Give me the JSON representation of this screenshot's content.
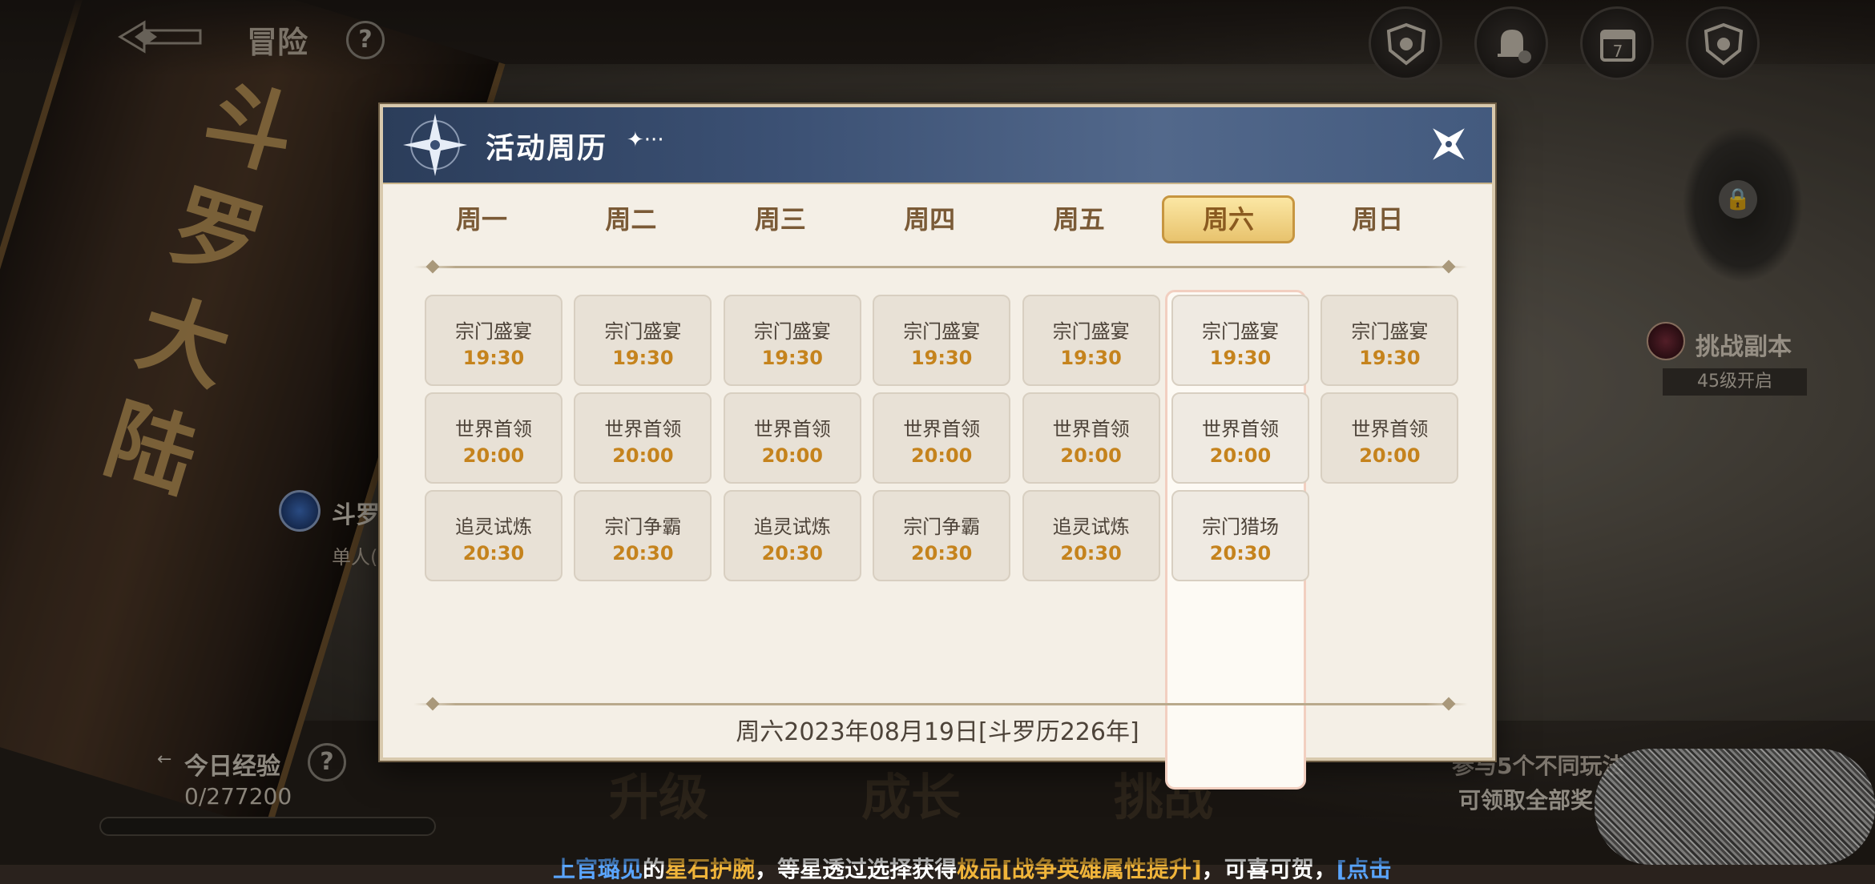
{
  "topbar": {
    "title": "冒险",
    "help": "?"
  },
  "pillar": {
    "text": "斗罗大陆"
  },
  "left_info": {
    "name": "斗罗",
    "sub": "单人("
  },
  "right_info": {
    "name": "挑战副本",
    "sub": "45级开启"
  },
  "bottom": {
    "exp_label": "今日经验",
    "exp_value": "0/277200",
    "exp_progress": 0.0,
    "tabs": [
      "升级",
      "成长",
      "挑战"
    ],
    "right_line1": "参与5个不同玩法",
    "right_line2": "可领取全部奖"
  },
  "marquee": {
    "p1": "上",
    "p2": "官璐见",
    "p3": "的",
    "p4": "星石护腕",
    "p5": "，等星透过选择获得",
    "p6": "极品",
    "p7": "[战争英雄属性提升]",
    "p8": "，可喜可贺，",
    "p9": "[点击"
  },
  "modal": {
    "title": "活动周历",
    "title_deco": "✦···",
    "days": [
      "周一",
      "周二",
      "周三",
      "周四",
      "周五",
      "周六",
      "周日"
    ],
    "active_day": "周六",
    "schedule": [
      [
        {
          "name": "宗门盛宴",
          "time": "19:30"
        },
        {
          "name": "世界首领",
          "time": "20:00"
        },
        {
          "name": "追灵试炼",
          "time": "20:30"
        }
      ],
      [
        {
          "name": "宗门盛宴",
          "time": "19:30"
        },
        {
          "name": "世界首领",
          "time": "20:00"
        },
        {
          "name": "宗门争霸",
          "time": "20:30"
        }
      ],
      [
        {
          "name": "宗门盛宴",
          "time": "19:30"
        },
        {
          "name": "世界首领",
          "time": "20:00"
        },
        {
          "name": "追灵试炼",
          "time": "20:30"
        }
      ],
      [
        {
          "name": "宗门盛宴",
          "time": "19:30"
        },
        {
          "name": "世界首领",
          "time": "20:00"
        },
        {
          "name": "宗门争霸",
          "time": "20:30"
        }
      ],
      [
        {
          "name": "宗门盛宴",
          "time": "19:30"
        },
        {
          "name": "世界首领",
          "time": "20:00"
        },
        {
          "name": "追灵试炼",
          "time": "20:30"
        }
      ],
      [
        {
          "name": "宗门盛宴",
          "time": "19:30"
        },
        {
          "name": "世界首领",
          "time": "20:00"
        },
        {
          "name": "宗门猎场",
          "time": "20:30"
        }
      ],
      [
        {
          "name": "宗门盛宴",
          "time": "19:30"
        },
        {
          "name": "世界首领",
          "time": "20:00"
        }
      ]
    ],
    "date": "周六2023年08月19日[斗罗历226年]"
  },
  "colors": {
    "header_blue": "#3b5073",
    "time_orange": "#c5831d",
    "active_gold": "#e8c36e"
  }
}
